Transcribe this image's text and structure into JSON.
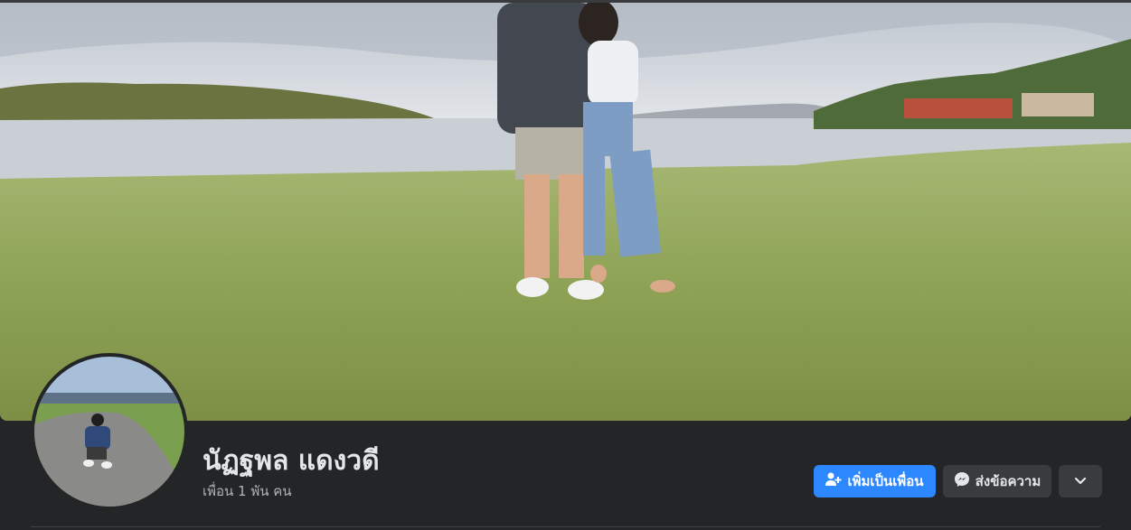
{
  "profile": {
    "name": "นัฏฐพล แดงวดี",
    "friends_count": "เพื่อน 1 พัน คน"
  },
  "actions": {
    "add_friend_label": "เพิ่มเป็นเพื่อน",
    "message_label": "ส่งข้อความ",
    "more_icon": "chevron-down-icon",
    "add_friend_icon": "add-friend-icon",
    "message_icon": "messenger-icon"
  },
  "colors": {
    "primary": "#2d88ff",
    "background": "#242526",
    "secondary_button": "#3a3b3c"
  }
}
